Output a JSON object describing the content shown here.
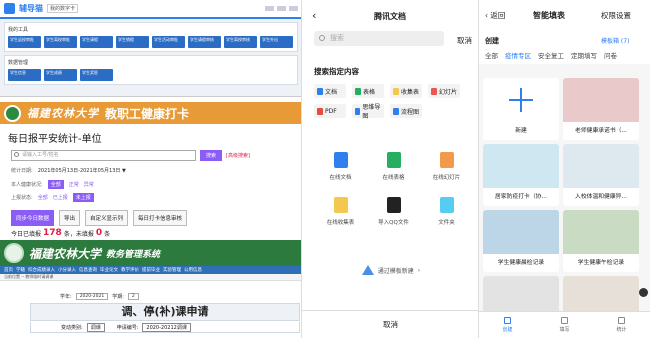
{
  "panel1": {
    "mini": {
      "brand": "辅导猫",
      "subtitle": "我的数字卡",
      "card1_title": "我的工具",
      "card1_tiles": [
        "学生返校审批",
        "学生离校审批",
        "学生请假",
        "学生销假",
        "学生活动审批",
        "学生请假审核",
        "学生离校审核",
        "学生外出"
      ],
      "card2_title": "数据管理",
      "card2_tiles": [
        "学生信息",
        "学生成绩",
        "学生奖惩"
      ]
    },
    "banner": {
      "school": "福建农林大学",
      "title": "教职工健康打卡"
    },
    "stat": {
      "title": "每日报平安统计-单位",
      "search_placeholder": "请输入工号/姓名",
      "search_btn": "搜索",
      "advanced_link": "[高级搜索]",
      "date_label": "统计日期:",
      "date_value": "2021年05月13日-2021年05月13日 ▼",
      "status_label": "本人健康状况:",
      "status_opts": [
        "全部",
        "正常",
        "异常"
      ],
      "report_label": "上报状态:",
      "report_opts": [
        "全部",
        "已上报",
        "未上报"
      ],
      "buttons": [
        "同步今日数据",
        "导出",
        "自定义显示列",
        "每日打卡信息审核"
      ],
      "summary_prefix": "今日已填报",
      "filled": "178",
      "summary_mid": "条，未填报",
      "unfilled": "0",
      "summary_suffix": "条"
    },
    "mgmt": {
      "school": "福建农林大学",
      "system": "教务管理系统",
      "nav": [
        "首页",
        "学籍",
        "综合成绩录入",
        "小分录入",
        "信息查询",
        "毕业论文",
        "教学评价",
        "提前毕业",
        "实验管理",
        "公用信息"
      ],
      "crumb": "当前位置 -- 教师临时请调课",
      "year_label": "学年:",
      "year_value": "2020-2021",
      "term_label": "学期:",
      "term_value": "2",
      "title": "调、停(补)课申请",
      "type_label": "变动类别:",
      "type_value": "调课",
      "no_label": "申请编号:",
      "no_value": "2020-20212调课"
    }
  },
  "panel2": {
    "back": "‹",
    "title": "腾讯文档",
    "search_placeholder": "搜索",
    "cancel": "取消",
    "section_title": "搜索指定内容",
    "file_types": [
      {
        "label": "文档",
        "color": "#2f80ed"
      },
      {
        "label": "表格",
        "color": "#27ae60"
      },
      {
        "label": "收集表",
        "color": "#f2c94c"
      },
      {
        "label": "幻灯片",
        "color": "#eb5757"
      },
      {
        "label": "PDF",
        "color": "#e74c3c"
      },
      {
        "label": "思维导图",
        "color": "#2f80ed"
      },
      {
        "label": "流程图",
        "color": "#2f80ed"
      }
    ],
    "apps": [
      {
        "label": "在线文档",
        "color": "#2f80ed"
      },
      {
        "label": "在线表格",
        "color": "#27ae60"
      },
      {
        "label": "在线幻灯片",
        "color": "#f2994a"
      },
      {
        "label": "在线收集表",
        "color": "#f2c94c"
      },
      {
        "label": "导入QQ文件",
        "color": "#222222"
      },
      {
        "label": "文件夹",
        "color": "#56ccf2"
      }
    ],
    "template_label": "通过模板新建",
    "bottom_cancel": "取消"
  },
  "panel3": {
    "back": "‹ 返回",
    "title": "智能填表",
    "perm": "权限设置",
    "create": "创建",
    "tip": "模板箱 (7)",
    "tabs": [
      "全部",
      "疫情专区",
      "安全复工",
      "定期填写",
      "问卷"
    ],
    "cards": [
      {
        "caption": "新建",
        "new": true,
        "color": "#ffffff"
      },
      {
        "caption": "老师健康承诺书（...",
        "color": "#e9c9c9"
      },
      {
        "caption": "居家防疫打卡（协...",
        "color": "#cfe7f0"
      },
      {
        "caption": "入校体温和健康异...",
        "color": "#dde8ef"
      },
      {
        "caption": "学生健康晨检记录",
        "color": "#bcd6e8"
      },
      {
        "caption": "学生健康午检记录",
        "color": "#c9dcc3"
      },
      {
        "caption": "",
        "color": "#e3e3e3"
      },
      {
        "caption": "",
        "color": "#e6e0d8"
      }
    ],
    "nav": [
      "创建",
      "填写",
      "统计"
    ]
  }
}
